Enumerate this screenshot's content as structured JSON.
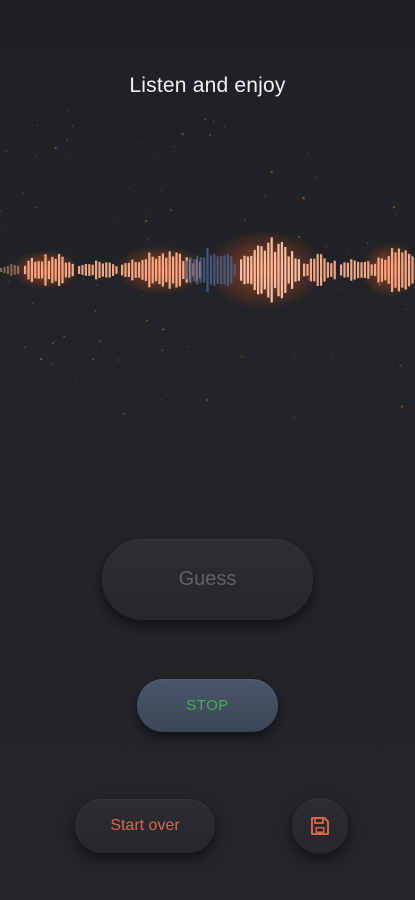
{
  "header": {
    "title": "Listen and enjoy"
  },
  "visualizer": {
    "played_color": "#ffb08a",
    "glow_color": "#ff5a1f",
    "unplayed_color": "#4a5f86"
  },
  "controls": {
    "guess_label": "Guess",
    "stop_label": "STOP",
    "start_over_label": "Start over",
    "save_icon": "floppy-disk-icon"
  },
  "colors": {
    "background": "#202226",
    "stop_text": "#4caa56",
    "stop_bg": "#445063",
    "accent": "#d9664a",
    "guess_text": "#5f6166"
  }
}
